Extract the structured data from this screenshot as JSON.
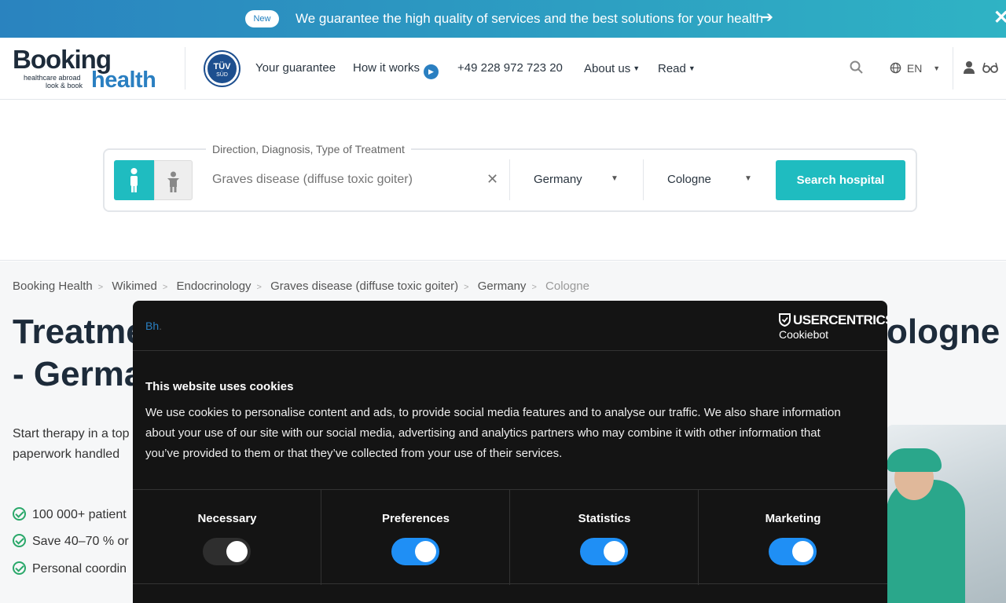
{
  "banner": {
    "badge": "New",
    "message": "We guarantee the high quality of services and the best solutions for your health",
    "arrow_icon": "arrow-right-icon",
    "close_icon": "close-icon"
  },
  "header": {
    "logo": {
      "booking": "Booking",
      "tagline1": "healthcare abroad",
      "tagline2": "look & book",
      "health": "health"
    },
    "tuv": {
      "main": "TÜV",
      "sub": "SÜD"
    },
    "nav": {
      "guarantee": "Your guarantee",
      "how_it_works": "How it works",
      "phone": "+49 228 972 723 20",
      "about": "About us",
      "read": "Read"
    },
    "lang": "EN"
  },
  "search": {
    "legend": "Direction, Diagnosis, Type of Treatment",
    "diagnosis_placeholder": "Graves disease (diffuse toxic goiter)",
    "country": "Germany",
    "city": "Cologne",
    "button": "Search hospital"
  },
  "breadcrumb": [
    "Booking Health",
    "Wikimed",
    "Endocrinology",
    "Graves disease (diffuse toxic goiter)",
    "Germany",
    "Cologne"
  ],
  "page": {
    "title_left_1": "Treatme",
    "title_right_1": "ologne",
    "title_left_2": "- Germa",
    "intro_1": "Start therapy in a top",
    "intro_2": "paperwork handled",
    "features": [
      "100 000+ patient",
      "Save 40–70 % or",
      "Personal coordin"
    ]
  },
  "cookie": {
    "brand": "Bh",
    "provider": "USERCENTRICS",
    "provider_sub": "Cookiebot",
    "title": "This website uses cookies",
    "text": "We use cookies to personalise content and ads, to provide social media features and to analyse our traffic. We also share information about your use of our site with our social media, advertising and analytics partners who may combine it with other information that you’ve provided to them or that they’ve collected from your use of their services.",
    "categories": [
      {
        "label": "Necessary",
        "on": true,
        "disabled": true
      },
      {
        "label": "Preferences",
        "on": true,
        "disabled": false
      },
      {
        "label": "Statistics",
        "on": true,
        "disabled": false
      },
      {
        "label": "Marketing",
        "on": true,
        "disabled": false
      }
    ],
    "toggle_color": "#1f8ff5"
  },
  "colors": {
    "accent": "#1fbcc0",
    "brand_blue": "#2a7fc1",
    "dark": "#1d2b3a"
  }
}
